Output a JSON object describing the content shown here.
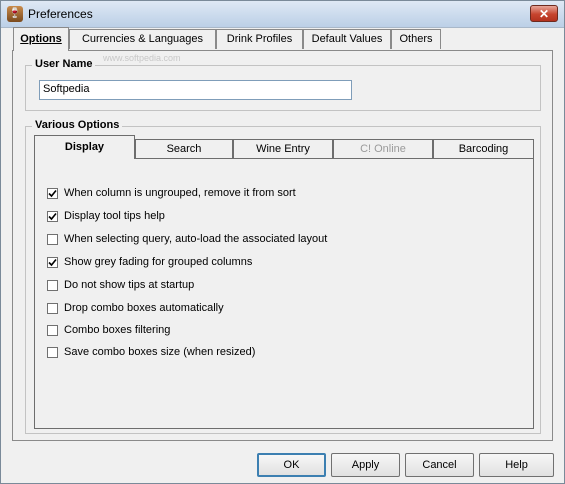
{
  "window": {
    "title": "Preferences",
    "close_label": "✕"
  },
  "outer_tabs": [
    {
      "label": "Options",
      "active": true
    },
    {
      "label": "Currencies & Languages"
    },
    {
      "label": "Drink Profiles"
    },
    {
      "label": "Default Values"
    },
    {
      "label": "Others"
    }
  ],
  "user_name": {
    "label": "User Name",
    "value": "Softpedia"
  },
  "watermark": "www.softpedia.com",
  "various": {
    "label": "Various Options",
    "tabs": [
      {
        "label": "Display",
        "active": true
      },
      {
        "label": "Search"
      },
      {
        "label": "Wine Entry"
      },
      {
        "label": "C! Online",
        "disabled": true
      },
      {
        "label": "Barcoding"
      }
    ],
    "options": [
      {
        "label": "When column is ungrouped, remove it from sort",
        "checked": true
      },
      {
        "label": "Display tool tips help",
        "checked": true
      },
      {
        "label": "When selecting query, auto-load the associated layout",
        "checked": false
      },
      {
        "label": "Show grey fading for grouped columns",
        "checked": true
      },
      {
        "label": "Do not show tips at startup",
        "checked": false
      },
      {
        "label": "Drop combo boxes automatically",
        "checked": false
      },
      {
        "label": "Combo boxes filtering",
        "checked": false
      },
      {
        "label": "Save combo boxes size (when resized)",
        "checked": false
      }
    ]
  },
  "buttons": {
    "ok": "OK",
    "apply": "Apply",
    "cancel": "Cancel",
    "help": "Help"
  },
  "icons": {
    "app": "wine-glass-icon",
    "check": "checkmark-icon"
  }
}
